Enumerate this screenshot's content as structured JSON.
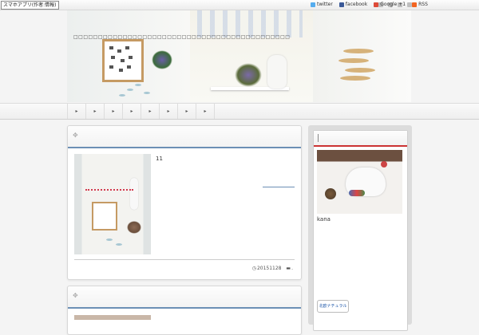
{
  "topbar": {
    "app_badge": "スマホアプリ(作者:情報)",
    "links": [
      {
        "label": "twitter",
        "icon": "twitter-icon",
        "color": "#55acee"
      },
      {
        "label": "facebook",
        "icon": "facebook-icon",
        "color": "#3b5998"
      },
      {
        "label": "Google +1",
        "icon": "google-plus-icon",
        "color": "#dd4b39"
      },
      {
        "label": "RSS",
        "icon": "rss-icon",
        "color": "#f26522"
      }
    ]
  },
  "header": {
    "site_title": "□□□□□□□□□□□□□□□□□□□□□□□□□□□□□□□□□□□□□□□□□□□□"
  },
  "nav": {
    "items": [
      "▸",
      "▸",
      "▸",
      "▸",
      "▸",
      "▸",
      "▸",
      "▸"
    ]
  },
  "post1": {
    "title_number": "11",
    "date": "20151128",
    "date_icon": "clock-icon",
    "category_icon": "folder-icon",
    "category": "."
  },
  "sidebar": {
    "profile_name": "kana",
    "banner_text": "北欧ナチュラル"
  },
  "colors": {
    "accent_blue": "#6c8fb5",
    "accent_red": "#cc3333"
  }
}
